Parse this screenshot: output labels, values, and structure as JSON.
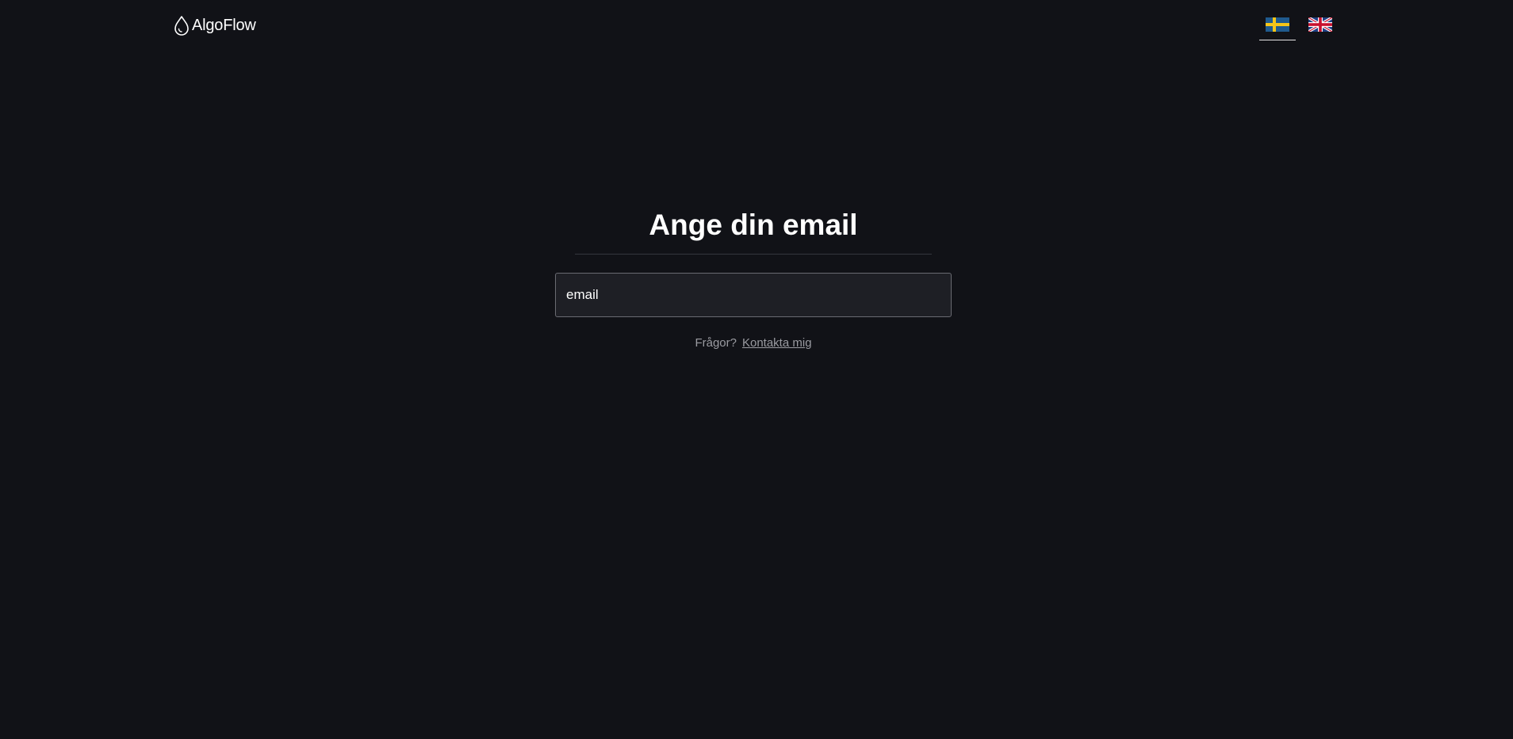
{
  "header": {
    "logo_text": "AlgoFlow",
    "logo_icon": "droplet-icon",
    "languages": [
      {
        "code": "sv",
        "icon": "swedish-flag-icon",
        "active": true
      },
      {
        "code": "en",
        "icon": "uk-flag-icon",
        "active": false
      }
    ]
  },
  "main": {
    "title": "Ange din email",
    "email_field": {
      "placeholder": "email",
      "value": ""
    },
    "help_text": "Frågor?",
    "contact_link": "Kontakta mig"
  },
  "colors": {
    "background": "#111217",
    "input_background": "#1e1f25",
    "input_border": "#6a6b72",
    "muted_text": "#9a9ba1",
    "swedish_blue": "#1f5a8e",
    "swedish_yellow": "#f5c518"
  }
}
